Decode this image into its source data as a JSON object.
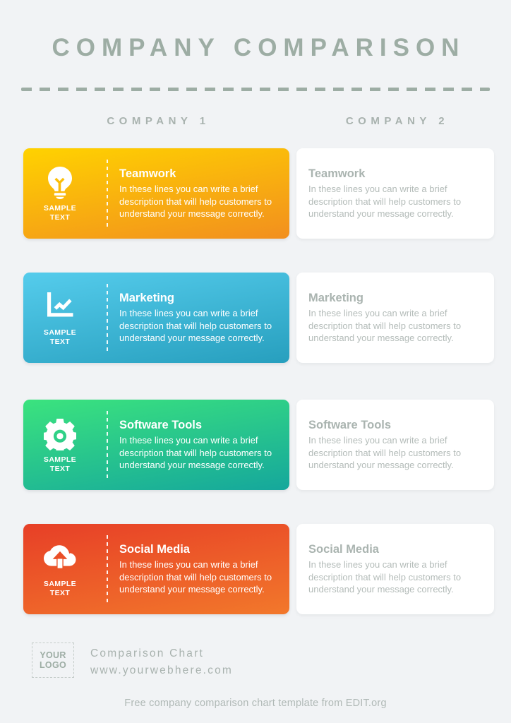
{
  "header": {
    "title": "COMPANY COMPARISON",
    "column_left": "COMPANY 1",
    "column_right": "COMPANY 2"
  },
  "rows": [
    {
      "icon": "lightbulb-icon",
      "sample_label": "SAMPLE\nTEXT",
      "gradient_from": "#FFD200",
      "gradient_to": "#F28F1E",
      "left": {
        "title": "Teamwork",
        "description": "In these lines you can write a brief description that will help customers to understand your message correctly."
      },
      "right": {
        "title": "Teamwork",
        "description": "In these lines you can write a brief description that will help customers to understand your message correctly."
      }
    },
    {
      "icon": "line-chart-icon",
      "sample_label": "SAMPLE\nTEXT",
      "gradient_from": "#55CCEC",
      "gradient_to": "#279FBE",
      "left": {
        "title": "Marketing",
        "description": "In these lines you can write a brief description that will help customers to understand your message correctly."
      },
      "right": {
        "title": "Marketing",
        "description": "In these lines you can write a brief description that will help customers to understand your message correctly."
      }
    },
    {
      "icon": "gear-icon",
      "sample_label": "SAMPLE\nTEXT",
      "gradient_from": "#3BE37E",
      "gradient_to": "#15A79C",
      "left": {
        "title": "Software Tools",
        "description": "In these lines you can write a brief description that will help customers to understand your message correctly."
      },
      "right": {
        "title": "Software Tools",
        "description": "In these lines you can write a brief description that will help customers to understand your message correctly."
      }
    },
    {
      "icon": "cloud-upload-icon",
      "sample_label": "SAMPLE\nTEXT",
      "gradient_from": "#E73F27",
      "gradient_to": "#F2782B",
      "left": {
        "title": "Social Media",
        "description": "In these lines you can write a brief description that will help customers to understand your message correctly."
      },
      "right": {
        "title": "Social Media",
        "description": "In these lines you can write a brief description that will help customers to understand your message correctly."
      }
    }
  ],
  "footer": {
    "logo_line1": "YOUR",
    "logo_line2": "LOGO",
    "line1": "Comparison Chart",
    "line2": "www.yourwebhere.com",
    "attribution": "Free company comparison chart template from EDIT.org"
  },
  "colors": {
    "background": "#F1F3F5",
    "title": "#9DADA4",
    "muted_text": "#AAB4B0",
    "card_white": "#FFFFFF"
  }
}
